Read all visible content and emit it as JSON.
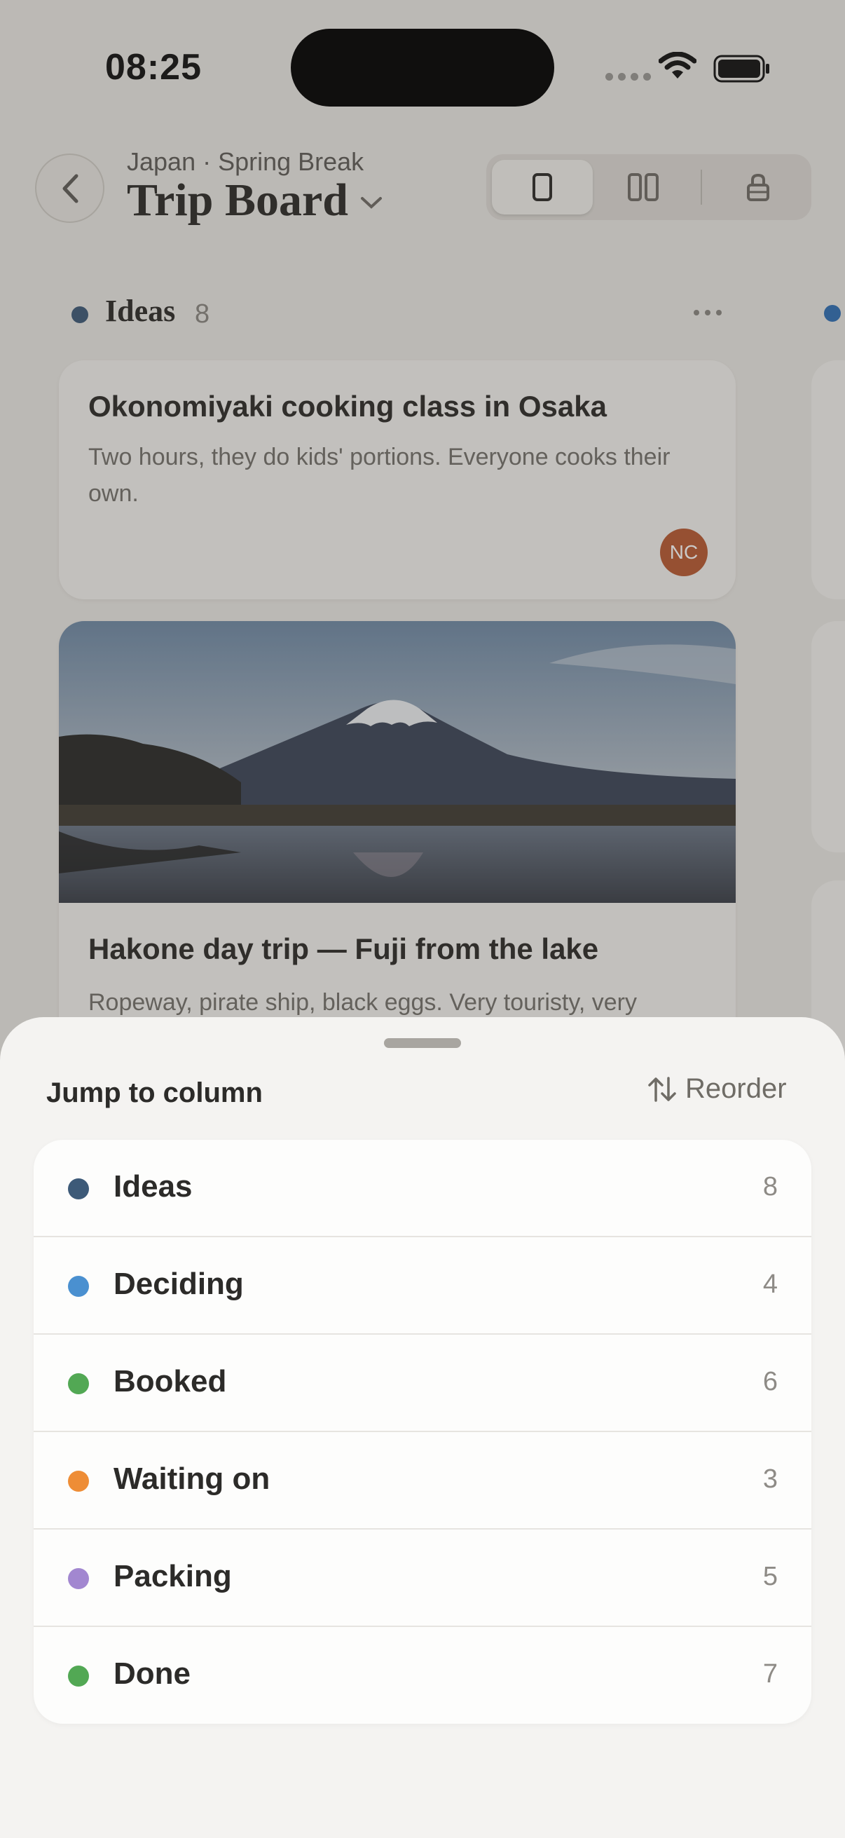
{
  "status": {
    "time": "08:25"
  },
  "header": {
    "subtitle": "Japan · Spring Break",
    "title": "Trip Board"
  },
  "board": {
    "column": {
      "name": "Ideas",
      "count": "8",
      "dot_color": "#3d5a78"
    },
    "cards": [
      {
        "title": "Okonomiyaki cooking class in Osaka",
        "body": "Two hours, they do kids' portions. Everyone cooks their own.",
        "avatar": "NC"
      },
      {
        "title": "Hakone day trip — Fuji from the lake",
        "body": "Ropeway, pirate ship, black eggs. Very touristy, very"
      }
    ]
  },
  "sheet": {
    "title": "Jump to column",
    "reorder_label": "Reorder",
    "columns": [
      {
        "name": "Ideas",
        "count": "8",
        "color": "#3d5a78"
      },
      {
        "name": "Deciding",
        "count": "4",
        "color": "#4a90d0"
      },
      {
        "name": "Booked",
        "count": "6",
        "color": "#52a854"
      },
      {
        "name": "Waiting on",
        "count": "3",
        "color": "#ee8d36"
      },
      {
        "name": "Packing",
        "count": "5",
        "color": "#a287d0"
      },
      {
        "name": "Done",
        "count": "7",
        "color": "#52a854"
      }
    ]
  }
}
